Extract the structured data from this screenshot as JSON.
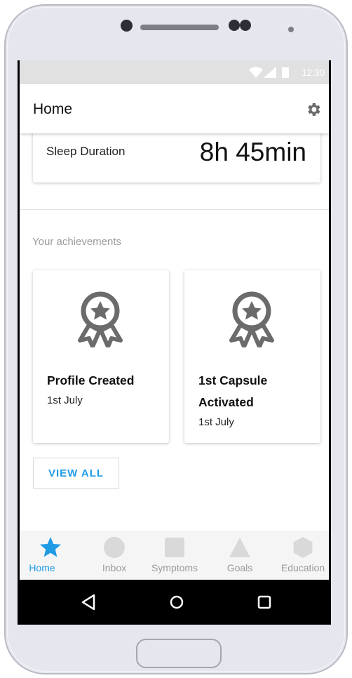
{
  "status_bar": {
    "time": "12:30"
  },
  "header": {
    "title": "Home",
    "settings_icon": "gear-icon"
  },
  "sleep": {
    "label": "Sleep Duration",
    "value": "8h 45min"
  },
  "achievements": {
    "section_label": "Your achievements",
    "items": [
      {
        "title": "Profile Created",
        "date": "1st July",
        "icon": "award-ribbon-icon"
      },
      {
        "title": "1st Capsule Activated",
        "date": "1st July",
        "icon": "award-ribbon-icon"
      }
    ],
    "view_all_label": "VIEW ALL"
  },
  "bottom_nav": {
    "items": [
      {
        "label": "Home",
        "icon": "star-icon",
        "active": true
      },
      {
        "label": "Inbox",
        "icon": "circle-icon",
        "active": false
      },
      {
        "label": "Symptoms",
        "icon": "square-icon",
        "active": false
      },
      {
        "label": "Goals",
        "icon": "triangle-icon",
        "active": false
      },
      {
        "label": "Education",
        "icon": "hexagon-icon",
        "active": false
      }
    ]
  },
  "colors": {
    "accent": "#1f9be6",
    "inactive_icon": "#d9d9d9",
    "badge_icon": "#6b6b6b"
  }
}
